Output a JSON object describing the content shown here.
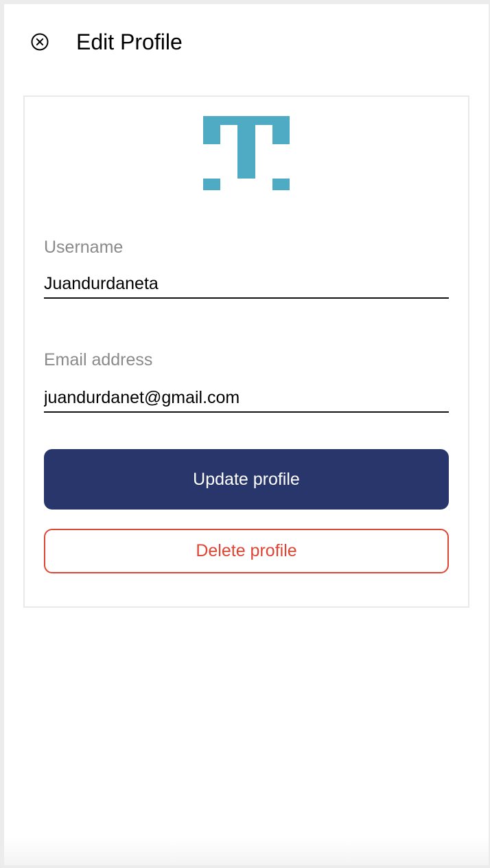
{
  "header": {
    "title": "Edit Profile",
    "close_icon": "close-circle-icon"
  },
  "logo": {
    "icon": "app-logo-t-icon",
    "color": "#4fabc3"
  },
  "form": {
    "username": {
      "label": "Username",
      "value": "Juandurdaneta"
    },
    "email": {
      "label": "Email address",
      "value": "juandurdanet@gmail.com"
    }
  },
  "actions": {
    "update_label": "Update profile",
    "delete_label": "Delete profile"
  },
  "colors": {
    "primary": "#28366c",
    "danger": "#e04432",
    "brand": "#4fabc3"
  }
}
